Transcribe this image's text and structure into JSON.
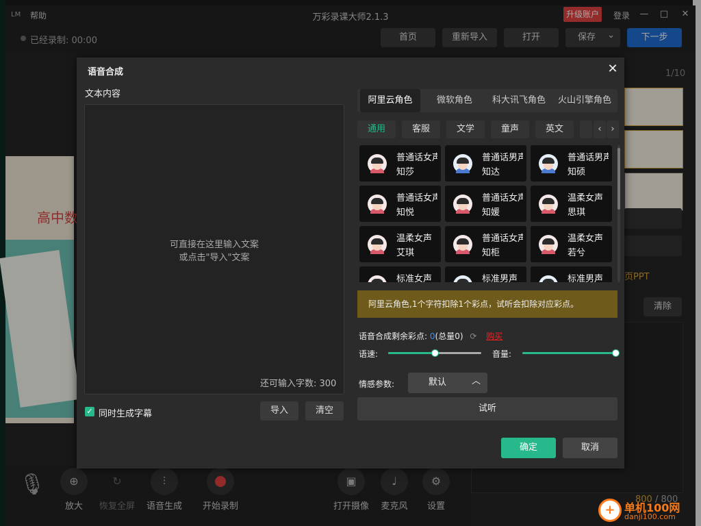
{
  "app": {
    "logo": "LM",
    "menu_help": "帮助",
    "title": "万彩录课大师2.1.3",
    "upgrade": "升级账户",
    "login": "登录",
    "minimize": "—",
    "maximize": "□",
    "close": "✕"
  },
  "toolbar": {
    "record_status": "已经录制: 00:00",
    "home": "首页",
    "reimport": "重新导入",
    "open": "打开",
    "save": "保存",
    "save_caret": "⌄",
    "next": "下一步"
  },
  "slide": {
    "text": "高中数"
  },
  "right_panel": {
    "pager": "1/10",
    "ppt_link": "页PPT",
    "clear": "清除",
    "count_used": "800",
    "count_sep": " / 800"
  },
  "bottom": {
    "zoom_in": "放大",
    "restore": "恢复全屏",
    "tts": "语音生成",
    "start_record": "开始录制",
    "camera": "打开摄像",
    "mic": "麦克风",
    "settings": "设置"
  },
  "dialog": {
    "title": "语音合成",
    "close": "✕",
    "text_label": "文本内容",
    "placeholder_line1": "可直接在这里输入文案",
    "placeholder_line2": "或点击\"导入\"文案",
    "remaining_chars": "还可输入字数: 300",
    "subtitle_checkbox": "同时生成字幕",
    "import": "导入",
    "clear": "清空",
    "role_tabs": [
      "阿里云角色",
      "微软角色",
      "科大讯飞角色",
      "火山引擎角色"
    ],
    "categories": [
      "通用",
      "客服",
      "文学",
      "童声",
      "英文"
    ],
    "arrow_prev": "‹",
    "arrow_next": "›",
    "voices": [
      {
        "line1": "普通话女声",
        "line2": "知莎",
        "gender": "f"
      },
      {
        "line1": "普通话男声",
        "line2": "知达",
        "gender": "m"
      },
      {
        "line1": "普通话男声",
        "line2": "知硕",
        "gender": "m"
      },
      {
        "line1": "普通话女声",
        "line2": "知悦",
        "gender": "f"
      },
      {
        "line1": "普通话女声",
        "line2": "知媛",
        "gender": "f"
      },
      {
        "line1": "温柔女声",
        "line2": "思琪",
        "gender": "f"
      },
      {
        "line1": "温柔女声",
        "line2": "艾琪",
        "gender": "f"
      },
      {
        "line1": "普通话女声",
        "line2": "知柜",
        "gender": "f"
      },
      {
        "line1": "温柔女声",
        "line2": "若兮",
        "gender": "f"
      },
      {
        "line1": "标准女声",
        "line2": "",
        "gender": "f"
      },
      {
        "line1": "标准男声",
        "line2": "",
        "gender": "m"
      },
      {
        "line1": "标准男声",
        "line2": "",
        "gender": "m"
      }
    ],
    "notice": "阿里云角色,1个字符扣除1个彩点，试听会扣除对应彩点。",
    "remaining_points_label": "语音合成剩余彩点:",
    "remaining_points_value": "0",
    "remaining_points_total": "(总量0)",
    "refresh_icon": "⟳",
    "buy": "购买",
    "speed_label": "语速:",
    "speed_level": 0.5,
    "volume_label": "音量:",
    "volume_level": 1.0,
    "emotion_label": "情感参数:",
    "emotion_value": "默认",
    "emotion_caret": "︿",
    "listen": "试听",
    "ok": "确定",
    "cancel": "取消"
  },
  "watermark": {
    "mark": "+",
    "name": "单机100网",
    "url": "danji100.com"
  },
  "colors": {
    "accent_green": "#27b98b",
    "accent_blue": "#1f6fd6",
    "danger_red": "#e24343",
    "notice_bg": "#6e5a1a"
  }
}
